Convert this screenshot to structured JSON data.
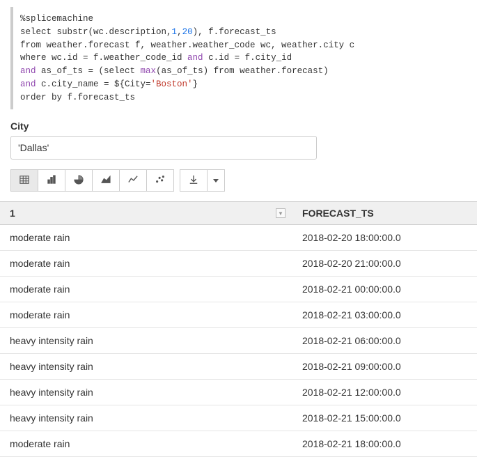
{
  "code": {
    "directive": "%splicemachine",
    "line2_a": "select substr(wc.description,",
    "line2_num1": "1",
    "line2_mid": ",",
    "line2_num2": "20",
    "line2_b": "), f.forecast_ts",
    "line3": "from weather.forecast f, weather.weather_code wc, weather.city c",
    "line4_a": "where wc.id = f.weather_code_id ",
    "line4_and": "and",
    "line4_b": " c.id = f.city_id",
    "line5_and": "and",
    "line5_a": " as_of_ts = (select ",
    "line5_max": "max",
    "line5_b": "(as_of_ts) from weather.forecast)",
    "line6_and": "and",
    "line6_a": " c.city_name = ${City=",
    "line6_str": "'Boston'",
    "line6_b": "}",
    "line7": "order by f.forecast_ts"
  },
  "form": {
    "city_label": "City",
    "city_value": "'Dallas'"
  },
  "toolbar": {
    "view_table": "table-view",
    "view_bar": "bar-chart-view",
    "view_pie": "pie-chart-view",
    "view_area": "area-chart-view",
    "view_line": "line-chart-view",
    "view_scatter": "scatter-chart-view",
    "download": "download"
  },
  "table": {
    "headers": {
      "col1": "1",
      "col2": "FORECAST_TS"
    },
    "rows": [
      {
        "c1": "moderate rain",
        "c2": "2018-02-20 18:00:00.0"
      },
      {
        "c1": "moderate rain",
        "c2": "2018-02-20 21:00:00.0"
      },
      {
        "c1": "moderate rain",
        "c2": "2018-02-21 00:00:00.0"
      },
      {
        "c1": "moderate rain",
        "c2": "2018-02-21 03:00:00.0"
      },
      {
        "c1": "heavy intensity rain",
        "c2": "2018-02-21 06:00:00.0"
      },
      {
        "c1": "heavy intensity rain",
        "c2": "2018-02-21 09:00:00.0"
      },
      {
        "c1": "heavy intensity rain",
        "c2": "2018-02-21 12:00:00.0"
      },
      {
        "c1": "heavy intensity rain",
        "c2": "2018-02-21 15:00:00.0"
      },
      {
        "c1": "moderate rain",
        "c2": "2018-02-21 18:00:00.0"
      }
    ]
  }
}
